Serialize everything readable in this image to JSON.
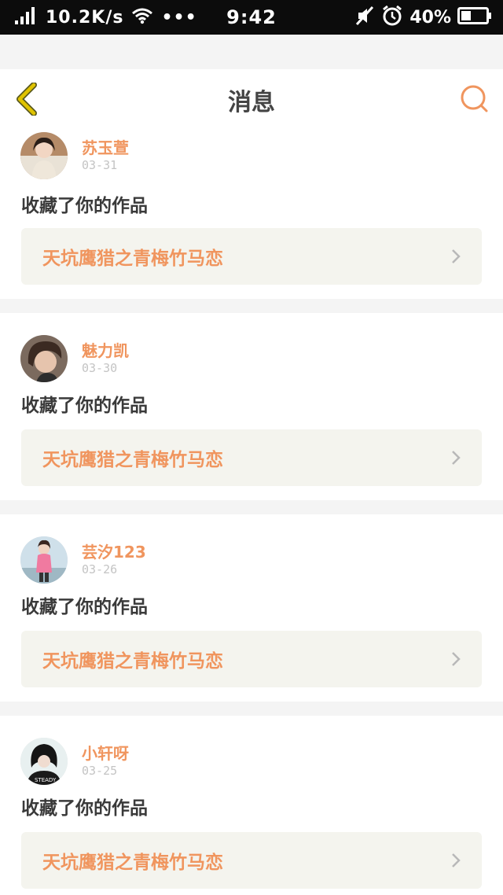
{
  "status_bar": {
    "net_speed": "10.2K/s",
    "dots": "•••",
    "time": "9:42",
    "battery_percent": "40%",
    "battery_level": 0.4,
    "icons": [
      "signal-icon",
      "wifi-icon",
      "mute-icon",
      "alarm-icon",
      "battery-icon"
    ]
  },
  "nav": {
    "title": "消息",
    "back_icon": "chevron-left-icon",
    "search_icon": "search-icon"
  },
  "colors": {
    "accent": "#f0955e",
    "back_icon": "#e0c300",
    "search_icon": "#f0955e",
    "work_bg": "#f4f4ee",
    "page_bg": "#f4f4f4"
  },
  "messages": [
    {
      "user": "苏玉萱",
      "date": "03-31",
      "action": "收藏了你的作品",
      "work": "天坑鹰猎之青梅竹马恋"
    },
    {
      "user": "魅力凯",
      "date": "03-30",
      "action": "收藏了你的作品",
      "work": "天坑鹰猎之青梅竹马恋"
    },
    {
      "user": "芸汐123",
      "date": "03-26",
      "action": "收藏了你的作品",
      "work": "天坑鹰猎之青梅竹马恋"
    },
    {
      "user": "小轩呀",
      "date": "03-25",
      "action": "收藏了你的作品",
      "work": "天坑鹰猎之青梅竹马恋"
    }
  ]
}
